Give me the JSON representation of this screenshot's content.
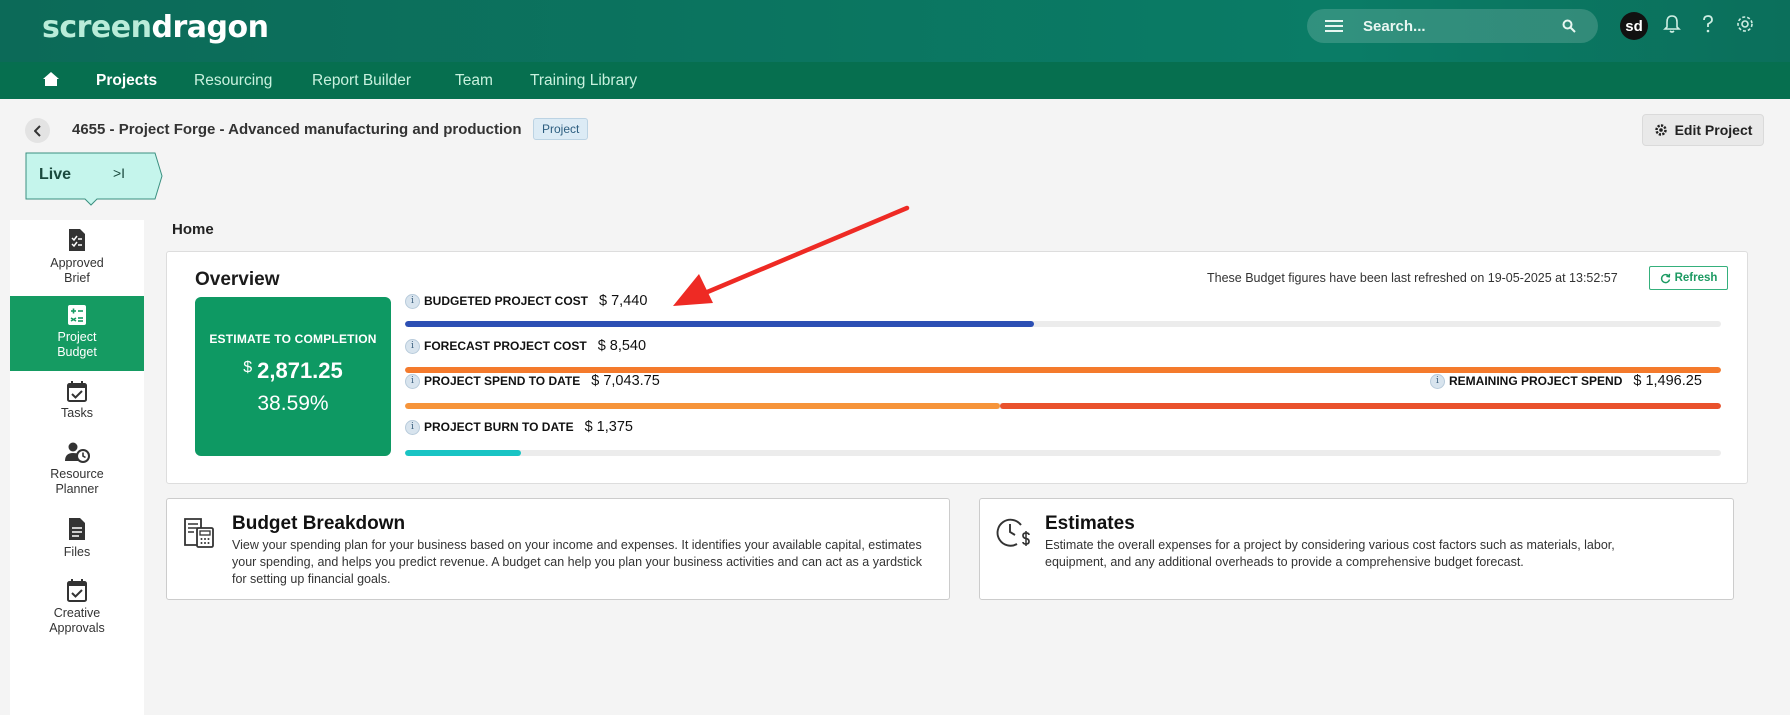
{
  "brand": {
    "logo_light": "screen",
    "logo_bold": "dragon"
  },
  "search": {
    "placeholder": "Search..."
  },
  "user": {
    "initials": "sd"
  },
  "nav": {
    "items": [
      "Projects",
      "Resourcing",
      "Report Builder",
      "Team",
      "Training Library"
    ],
    "active": "Projects"
  },
  "project": {
    "title": "4655 - Project Forge - Advanced manufacturing and production",
    "badge": "Project",
    "status": "Live",
    "status_jump": ">I"
  },
  "actions": {
    "edit_project": "Edit Project"
  },
  "sidebar": {
    "items": [
      {
        "label": "Approved Brief",
        "icon": "brief-icon"
      },
      {
        "label": "Project Budget",
        "icon": "budget-icon",
        "active": true
      },
      {
        "label": "Tasks",
        "icon": "tasks-icon"
      },
      {
        "label": "Resource Planner",
        "icon": "resource-planner-icon"
      },
      {
        "label": "Files",
        "icon": "files-icon"
      },
      {
        "label": "Creative Approvals",
        "icon": "creative-approvals-icon"
      }
    ]
  },
  "breadcrumb": "Home",
  "overview": {
    "title": "Overview",
    "refresh_text": "These Budget figures have been last refreshed on 19-05-2025 at 13:52:57",
    "refresh_label": "Refresh",
    "etc": {
      "label": "ESTIMATE TO COMPLETION",
      "currency": "$",
      "amount": "2,871.25",
      "percent": "38.59%"
    },
    "metrics": {
      "budgeted": {
        "label": "BUDGETED PROJECT COST",
        "value": "$ 7,440",
        "fraction": 0.478
      },
      "forecast": {
        "label": "FORECAST PROJECT COST",
        "value": "$ 8,540",
        "fraction": 1.0
      },
      "spend": {
        "label": "PROJECT SPEND TO DATE",
        "value": "$ 7,043.75",
        "fraction": 0.452
      },
      "remaining": {
        "label": "REMAINING PROJECT SPEND",
        "value": "$ 1,496.25",
        "fraction": 0.548
      },
      "burn": {
        "label": "PROJECT BURN TO DATE",
        "value": "$ 1,375",
        "fraction": 0.088
      }
    },
    "colors": {
      "budgeted": "#2c4fb4",
      "forecast": "#f47a2c",
      "spend": "#f6943a",
      "remaining": "#e9512c",
      "burn": "#19c4c4"
    }
  },
  "cards": {
    "budget_breakdown": {
      "title": "Budget Breakdown",
      "desc": "View your spending plan for your business based on your income and expenses. It identifies your available capital, estimates your spending, and helps you predict revenue. A budget can help you plan your business activities and can act as a yardstick for setting up financial goals."
    },
    "estimates": {
      "title": "Estimates",
      "desc": "Estimate the overall expenses for a project by considering various cost factors such as materials, labor, equipment, and any additional overheads to provide a comprehensive budget forecast."
    }
  }
}
